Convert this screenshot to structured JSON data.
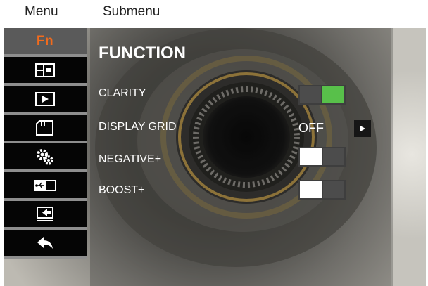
{
  "header": {
    "menu_label": "Menu",
    "submenu_label": "Submenu"
  },
  "sidebar": {
    "fn_label": "Fn",
    "items": [
      {
        "icon": "fn-label",
        "active": true
      },
      {
        "icon": "layout-icon"
      },
      {
        "icon": "play-icon"
      },
      {
        "icon": "sd-card-icon"
      },
      {
        "icon": "settings-gears-icon"
      },
      {
        "icon": "usb-icon"
      },
      {
        "icon": "export-icon"
      },
      {
        "icon": "back-arrow-icon"
      }
    ]
  },
  "panel": {
    "title": "FUNCTION",
    "rows": [
      {
        "label": "CLARITY",
        "control": "toggle",
        "state": "on"
      },
      {
        "label": "DISPLAY GRID",
        "control": "value",
        "value": "OFF"
      },
      {
        "label": "NEGATIVE+",
        "control": "toggle",
        "state": "off"
      },
      {
        "label": "BOOST+",
        "control": "toggle",
        "state": "off"
      }
    ]
  },
  "colors": {
    "accent_on": "#58c04a",
    "fn_orange": "#f26b1d",
    "sidebar_bg": "#050505"
  }
}
